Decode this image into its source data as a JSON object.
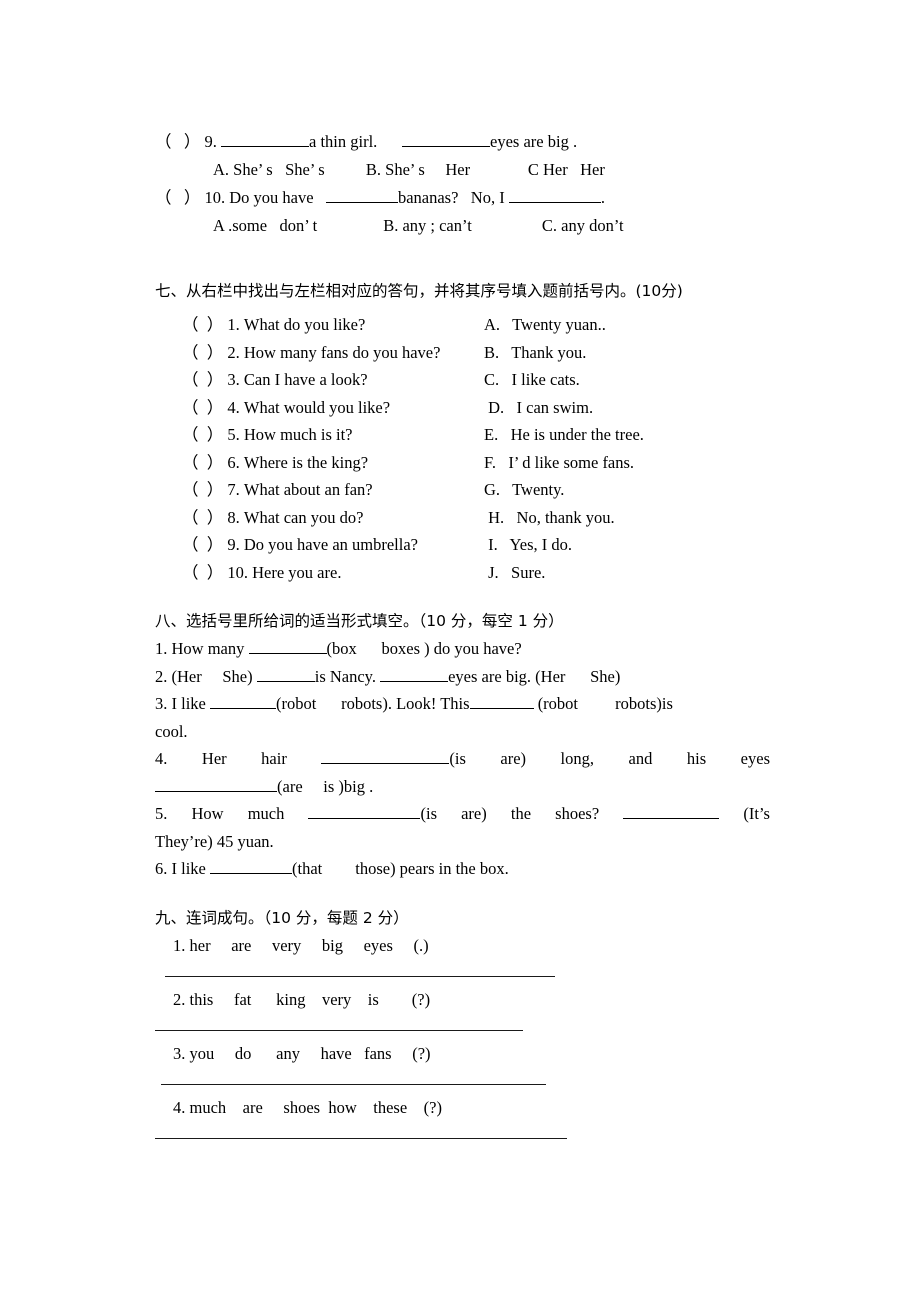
{
  "document": {
    "type": "english-exam-worksheet",
    "language": "zh-CN"
  },
  "multiple_choice_tail": {
    "items": [
      {
        "marker": "（   ） 9.",
        "question_before": "（   ） 9. ",
        "question_after": "a thin girl.      ",
        "question_after2": "eyes are big .",
        "options": "A. She’ s   She’ s          B. She’ s     Her              C Her   Her"
      },
      {
        "question_before": "（   ） 10. Do you have   ",
        "question_after": "bananas?   No, I ",
        "question_after2": ".",
        "options": "A .some   don’ t                B. any ; can’t                 C. any don’t"
      }
    ]
  },
  "section_seven": {
    "heading": "七、从右栏中找出与左栏相对应的答句，并将其序号填入题前括号内。(10分)",
    "rows": [
      {
        "left": "（  ） 1. What do you like?",
        "right": "A.   Twenty yuan.."
      },
      {
        "left": "（  ） 2. How many fans do you have?",
        "right": "B.   Thank you."
      },
      {
        "left": "（  ） 3. Can I have a look?",
        "right": "C.   I like cats."
      },
      {
        "left": "（  ） 4. What would you like?",
        "right": " D.   I can swim."
      },
      {
        "left": "（  ） 5. How much is it?",
        "right": "E.   He is under the tree."
      },
      {
        "left": "（  ） 6. Where is the king?",
        "right": "F.   I’ d like some fans."
      },
      {
        "left": "（  ） 7. What about an fan?",
        "right": "G.   Twenty."
      },
      {
        "left": "（  ） 8. What can you do?",
        "right": " H.   No, thank you."
      },
      {
        "left": "（  ） 9. Do you have an umbrella?",
        "right": " I.   Yes, I do."
      },
      {
        "left": "（  ） 10. Here you are.",
        "right": " J.   Sure."
      }
    ]
  },
  "section_eight": {
    "heading": "八、选括号里所给词的适当形式填空。（10 分，每空 1 分）",
    "items": [
      {
        "id": "q1",
        "before": "1. How many ",
        "after": "(box      boxes ) do you have?"
      },
      {
        "id": "q2",
        "before": "2. (Her     She) ",
        "mid": "is Nancy. ",
        "after": "eyes are big. (Her      She)"
      },
      {
        "id": "q3",
        "before": "3. I like ",
        "mid": "(robot      robots). Look! This",
        "after": " (robot         robots)is",
        "continuation": "cool."
      },
      {
        "id": "q4",
        "before": "4. Her hair ",
        "after": "(is                are)  long,  and  his  eyes",
        "continuation_before": "",
        "continuation_after": "(are     is )big ."
      },
      {
        "id": "q5",
        "before": "5. How much ",
        "mid": "(is         are)  the  shoes? ",
        "after": " (It’s",
        "continuation": "They’re) 45 yuan."
      },
      {
        "id": "q6",
        "before": "6. I like ",
        "after": "(that        those) pears in the box."
      }
    ]
  },
  "section_nine": {
    "heading": "九、连词成句。（10 分，每题 2 分）",
    "items": [
      {
        "words": "1. her     are     very     big     eyes     (.)"
      },
      {
        "words": "2. this     fat      king    very    is        (?)"
      },
      {
        "words": "3. you     do      any     have   fans     (?)"
      },
      {
        "words": "4. much    are     shoes  how    these    (?)"
      }
    ]
  }
}
